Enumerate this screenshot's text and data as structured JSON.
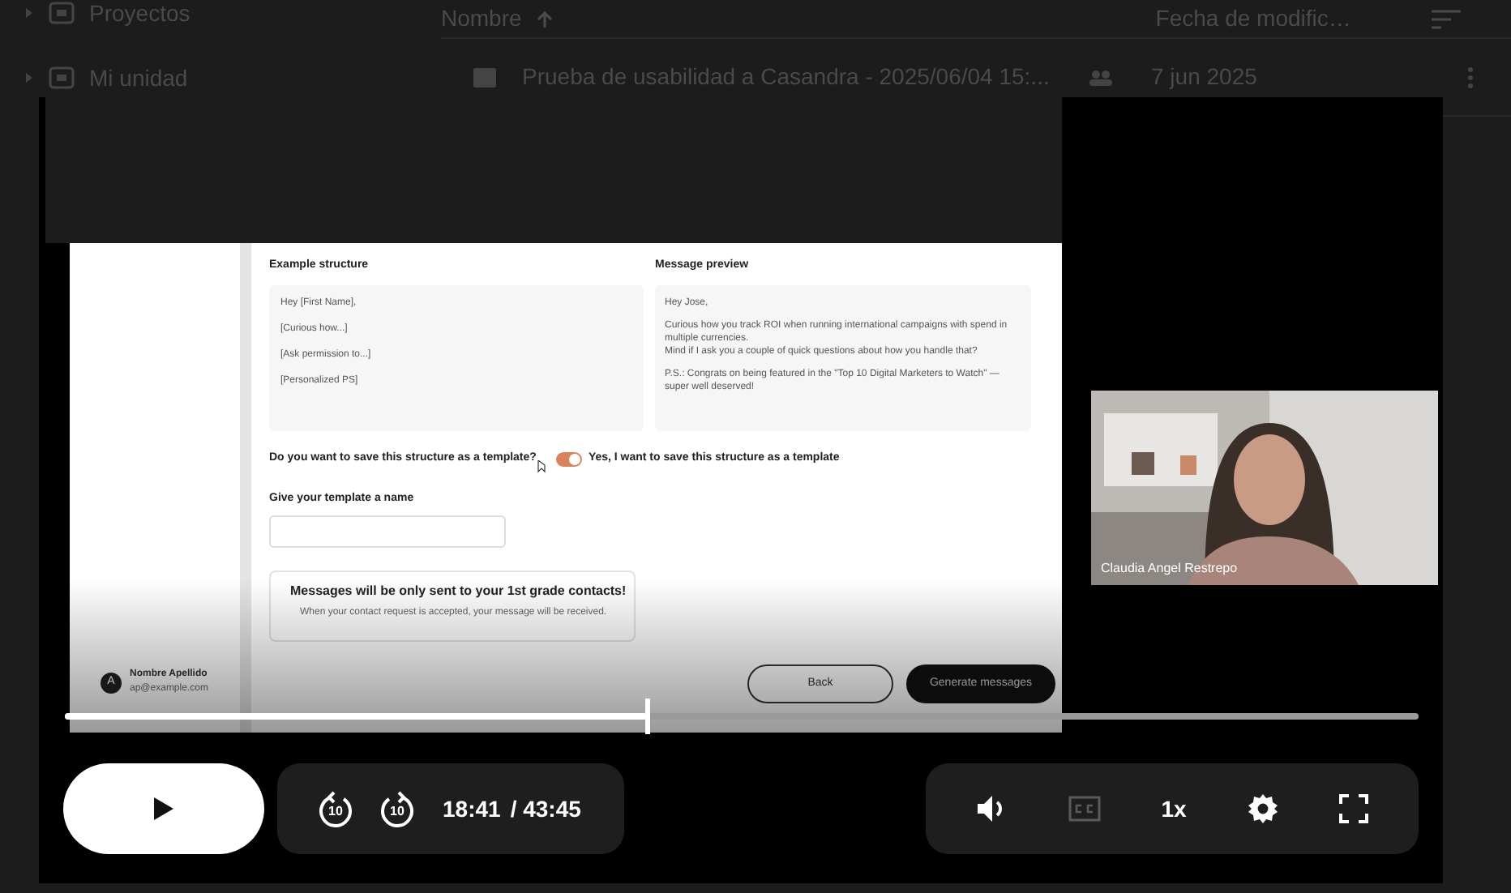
{
  "drive": {
    "sidebar": [
      {
        "label": "Proyectos"
      },
      {
        "label": "Mi unidad"
      }
    ],
    "columns": [
      "Nombre",
      "Fecha de modific…"
    ],
    "rows": [
      {
        "name": "Prueba de usabilidad a Casandra - 2025/06/04 15:...",
        "date": "7 jun 2025"
      }
    ]
  },
  "player": {
    "recording": {
      "user": {
        "avatar": "A",
        "name": "Nombre Apellido",
        "email": "ap@example.com"
      },
      "structure": {
        "title": "Example structure",
        "lines": [
          "Hey [First Name],",
          "[Curious how...]",
          "[Ask permission to...]",
          "[Personalized PS]"
        ]
      },
      "preview": {
        "title": "Message preview",
        "paragraphs": [
          "Hey Jose,",
          "Curious how you track ROI when running international campaigns with spend in multiple currencies.\n Mind if I ask you a couple of quick questions about how you handle that?",
          "P.S.: Congrats on being featured in the \"Top 10 Digital Marketers to Watch\" — super well deserved!"
        ]
      },
      "template": {
        "question": "Do you want to save this structure as a template?",
        "checked": true,
        "label": "Yes, I want to save this structure as a template"
      },
      "name_field": {
        "label": "Give your template a name"
      },
      "notice": {
        "title": "Messages will be only sent to your 1st grade contacts!",
        "body": "When your contact request is accepted, your message will be received."
      },
      "buttons": [
        {
          "label": "Back",
          "kind": "secondary"
        },
        {
          "label": "Generate messages",
          "kind": "primary"
        }
      ]
    },
    "webcam": {
      "name": "Claudia Angel Restrepo"
    },
    "progress": {
      "level": 0.43
    },
    "skip_back": "10",
    "skip_forward": "10",
    "time": "18:41",
    "duration": "/ 43:45",
    "captions": {
      "on": false
    },
    "speed": "1x"
  }
}
